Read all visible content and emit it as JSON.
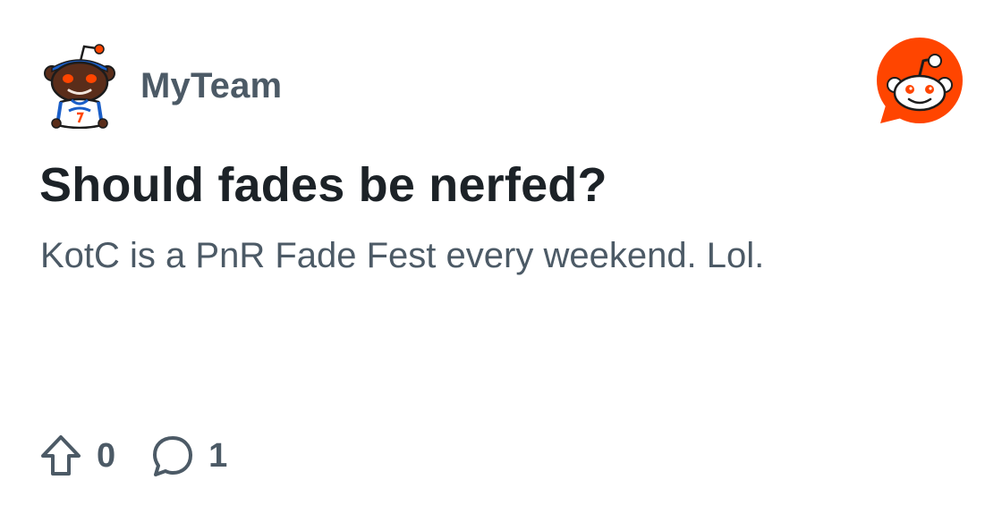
{
  "community": {
    "name": "MyTeam",
    "avatar_icon": "snoo-knicks-jersey-avatar"
  },
  "brand": {
    "logo_icon": "reddit-logo-icon",
    "color": "#ff4500"
  },
  "post": {
    "title": "Should fades be nerfed?",
    "body": "KotC is a PnR Fade Fest every weekend. Lol."
  },
  "actions": {
    "upvote_icon": "upvote-arrow-icon",
    "votes": "0",
    "comment_icon": "comment-bubble-icon",
    "comments": "1"
  },
  "colors": {
    "title": "#1c2227",
    "secondary_text": "#4c5a66",
    "brand": "#ff4500"
  }
}
